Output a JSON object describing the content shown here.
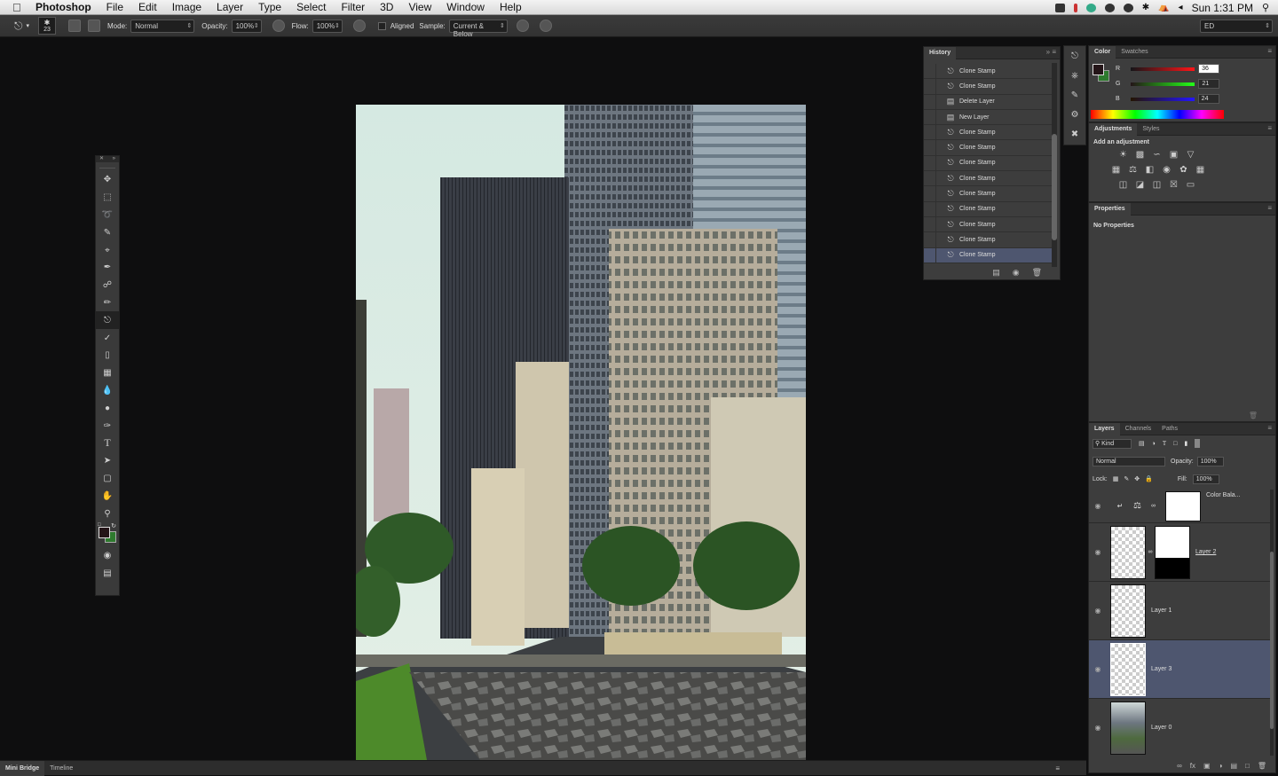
{
  "menubar": {
    "app_name": "Photoshop",
    "menus": [
      "File",
      "Edit",
      "Image",
      "Layer",
      "Type",
      "Select",
      "Filter",
      "3D",
      "View",
      "Window",
      "Help"
    ],
    "clock": "Sun 1:31 PM"
  },
  "options": {
    "brush_size": "23",
    "mode_label": "Mode:",
    "mode_value": "Normal",
    "opacity_label": "Opacity:",
    "opacity_value": "100%",
    "flow_label": "Flow:",
    "flow_value": "100%",
    "aligned_label": "Aligned",
    "sample_label": "Sample:",
    "sample_value": "Current & Below",
    "workspace": "ED"
  },
  "toolbar": {
    "tools": [
      "move",
      "marquee",
      "lasso",
      "quick-select",
      "crop",
      "eyedropper",
      "healing",
      "brush",
      "clone-stamp",
      "history-brush",
      "eraser",
      "gradient",
      "blur",
      "dodge",
      "pen",
      "type",
      "path-select",
      "shape",
      "hand",
      "zoom"
    ]
  },
  "history": {
    "tab": "History",
    "items": [
      "Clone Stamp",
      "Clone Stamp",
      "Delete Layer",
      "New Layer",
      "Clone Stamp",
      "Clone Stamp",
      "Clone Stamp",
      "Clone Stamp",
      "Clone Stamp",
      "Clone Stamp",
      "Clone Stamp",
      "Clone Stamp",
      "Clone Stamp"
    ]
  },
  "color": {
    "tab_color": "Color",
    "tab_swatches": "Swatches",
    "r_label": "R",
    "g_label": "G",
    "b_label": "B",
    "r": "36",
    "g": "21",
    "b": "24",
    "foreground": "#241518",
    "background": "#2e7a2e"
  },
  "adjustments": {
    "tab_adjustments": "Adjustments",
    "tab_styles": "Styles",
    "heading": "Add an adjustment"
  },
  "properties": {
    "tab": "Properties",
    "empty_text": "No Properties"
  },
  "layers": {
    "tab_layers": "Layers",
    "tab_channels": "Channels",
    "tab_paths": "Paths",
    "kind_label": "Kind",
    "blend_mode": "Normal",
    "opacity_label": "Opacity:",
    "opacity": "100%",
    "lock_label": "Lock:",
    "fill_label": "Fill:",
    "fill": "100%",
    "items": [
      {
        "name": "Color Bala..."
      },
      {
        "name": "Layer 2"
      },
      {
        "name": "Layer 1"
      },
      {
        "name": "Layer 3"
      },
      {
        "name": "Layer 0"
      }
    ]
  },
  "statusbar": {
    "tab_minibridge": "Mini Bridge",
    "tab_timeline": "Timeline"
  },
  "colors": {
    "selection": "#4e566f",
    "panel": "#3d3d3d",
    "canvas_bg": "#0e0e0f"
  }
}
